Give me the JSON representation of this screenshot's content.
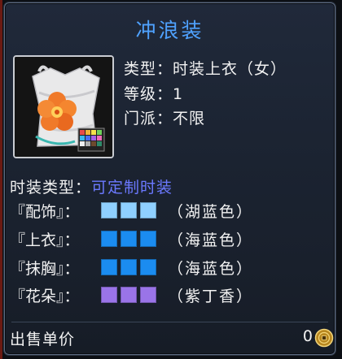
{
  "colors": {
    "title": "#4fa2ff",
    "custom_type": "#6b79ff",
    "lake_blue": "#8fd0ff",
    "sea_blue": "#1b8cf0",
    "lilac": "#9a74e8"
  },
  "item": {
    "name": "冲浪装",
    "icon": "surf-outfit-top-icon",
    "type_line": "类型：时装上衣（女）",
    "level_line": "等级：1",
    "sect_line": "门派：不限"
  },
  "customization": {
    "label": "时装类型：",
    "value": "可定制时装"
  },
  "dyes": [
    {
      "part": "『配饰』：",
      "swatch": "#8fd0ff",
      "color_name": "（湖蓝色）"
    },
    {
      "part": "『上衣』：",
      "swatch": "#1b8cf0",
      "color_name": "（海蓝色）"
    },
    {
      "part": "『抹胸』：",
      "swatch": "#1b8cf0",
      "color_name": "（海蓝色）"
    },
    {
      "part": "『花朵』：",
      "swatch": "#9a74e8",
      "color_name": "（紫丁香）"
    }
  ],
  "price": {
    "label": "出售单价",
    "value": "0",
    "icon": "coin-icon"
  }
}
